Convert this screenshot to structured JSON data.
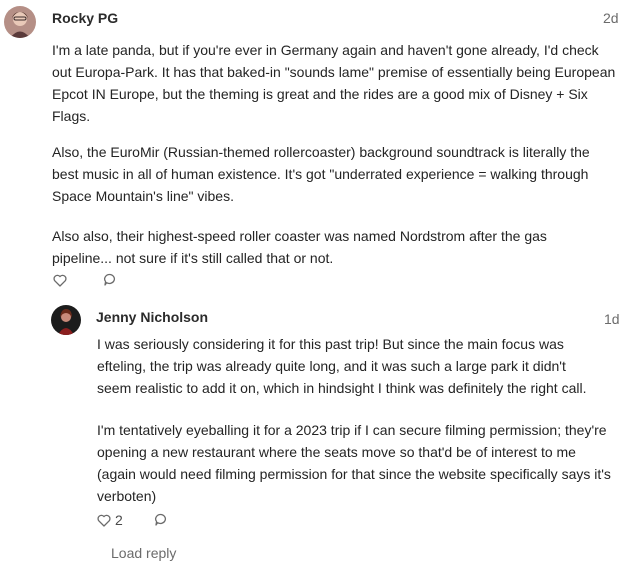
{
  "comments": [
    {
      "author": "Rocky PG",
      "time": "2d",
      "paragraphs": [
        "I'm a late panda, but if you're ever in Germany again and haven't gone already, I'd check out Europa-Park. It has that baked-in \"sounds lame\" premise of essentially being European Epcot IN Europe, but the theming is great and the rides are a good mix of Disney + Six Flags.",
        "Also, the EuroMir (Russian-themed rollercoaster) background soundtrack is literally the best music in all of human existence. It's got \"underrated experience = walking through Space Mountain's line\" vibes.",
        "Also also, their highest-speed roller coaster was named Nordstrom after the gas pipeline... not sure if it's still called that or not."
      ],
      "like_count": ""
    },
    {
      "author": "Jenny Nicholson",
      "time": "1d",
      "paragraphs": [
        "I was seriously considering it for this past trip! But since the main focus was efteling, the trip was already quite long, and it was such a large park it didn't seem realistic to add it on, which in hindsight I think was definitely the right call.",
        "I'm tentatively eyeballing it for a 2023 trip if I can secure filming permission; they're opening a new restaurant where the seats move so that'd be of interest to me (again would need filming permission for that since the website specifically says it's verboten)"
      ],
      "like_count": "2"
    }
  ],
  "load_reply": "Load reply",
  "colors": {
    "muted": "#6b6b6b",
    "text": "#242424"
  },
  "icons": [
    "heart-icon",
    "comment-icon"
  ]
}
